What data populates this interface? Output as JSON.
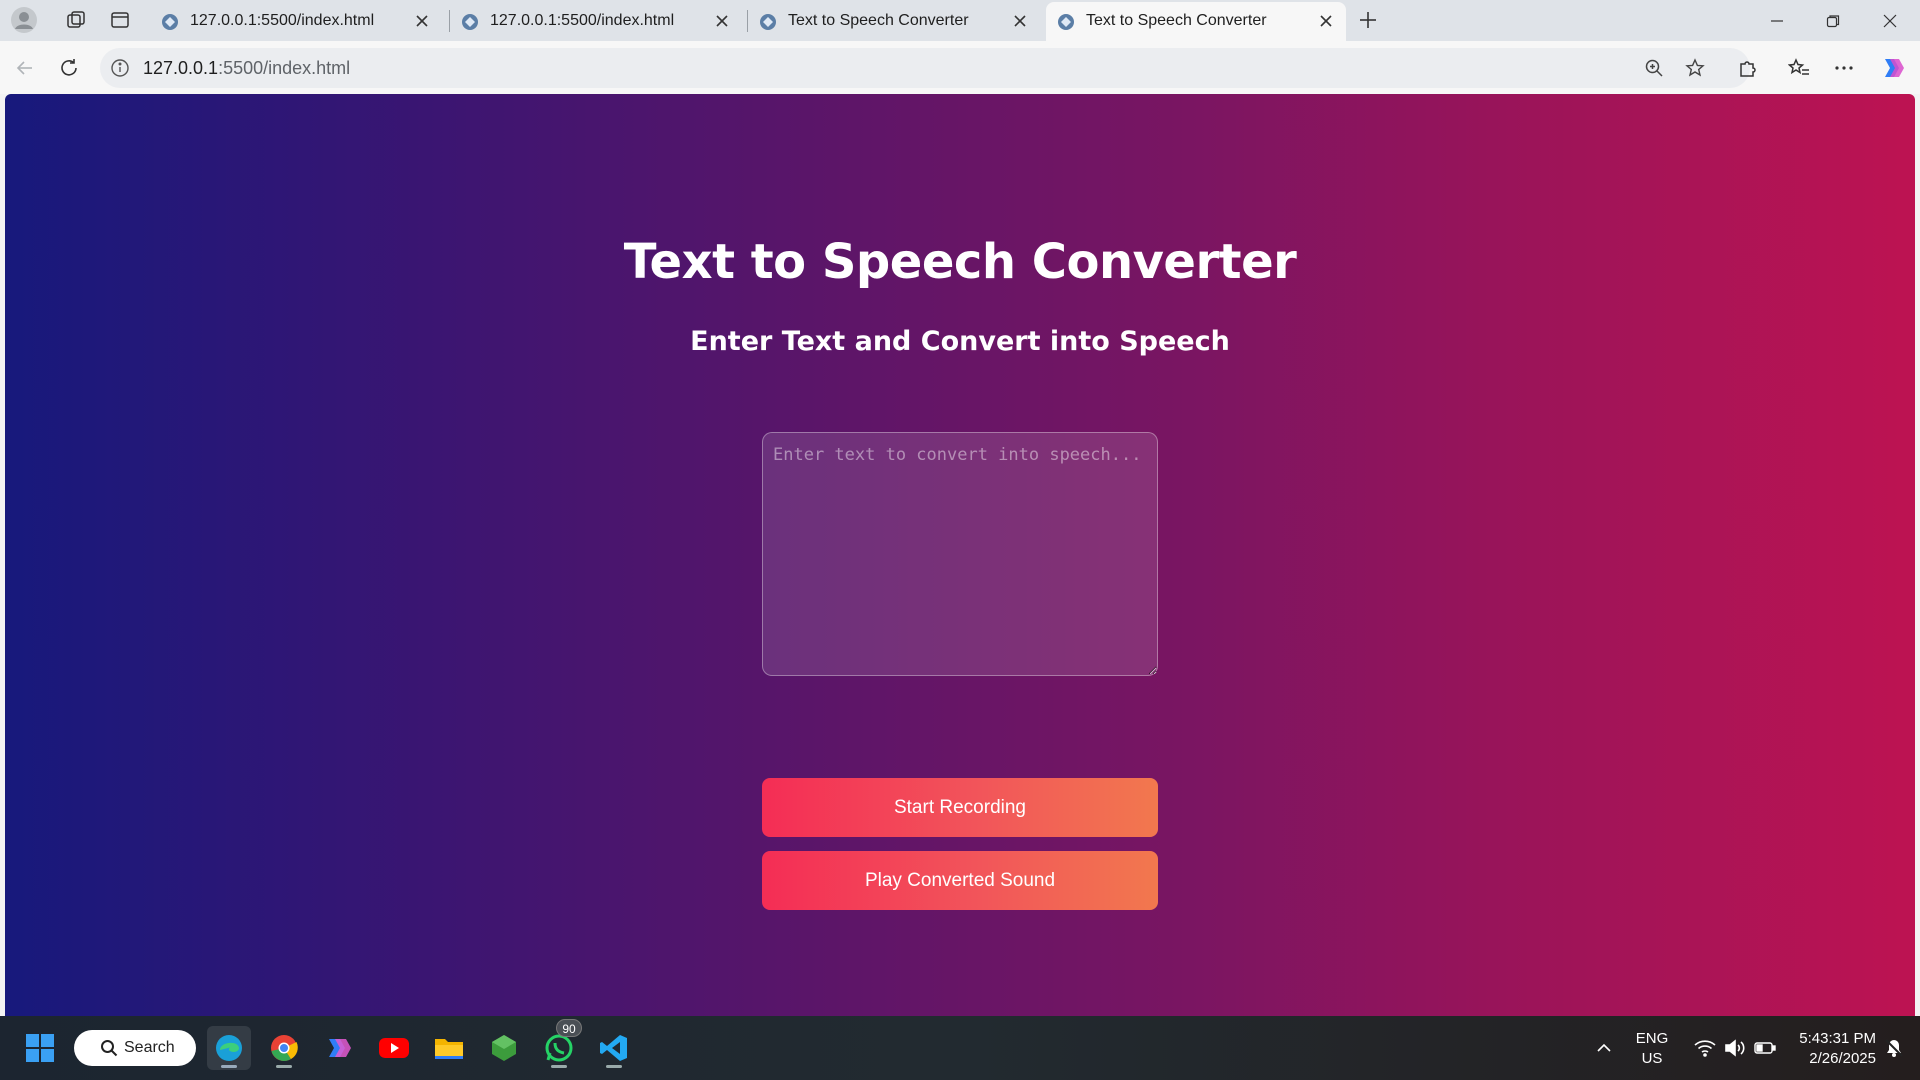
{
  "browser": {
    "tabs": [
      {
        "title": "127.0.0.1:5500/index.html",
        "active": false
      },
      {
        "title": "127.0.0.1:5500/index.html",
        "active": false
      },
      {
        "title": "Text to Speech Converter",
        "active": false
      },
      {
        "title": "Text to Speech Converter",
        "active": true
      }
    ],
    "address": {
      "host": "127.0.0.1",
      "path": ":5500/index.html"
    }
  },
  "page": {
    "title": "Text to Speech Converter",
    "subtitle": "Enter Text and Convert into Speech",
    "textarea_placeholder": "Enter text to convert into speech...",
    "textarea_value": "",
    "start_button": "Start Recording",
    "play_button": "Play Converted Sound"
  },
  "taskbar": {
    "search_label": "Search",
    "whatsapp_badge": "90",
    "language_line1": "ENG",
    "language_line2": "US",
    "time": "5:43:31 PM",
    "date": "2/26/2025"
  },
  "colors": {
    "gradient_start": "#17197c",
    "gradient_end": "#bd1352",
    "button_start": "#f42d55",
    "button_end": "#f2784e"
  }
}
